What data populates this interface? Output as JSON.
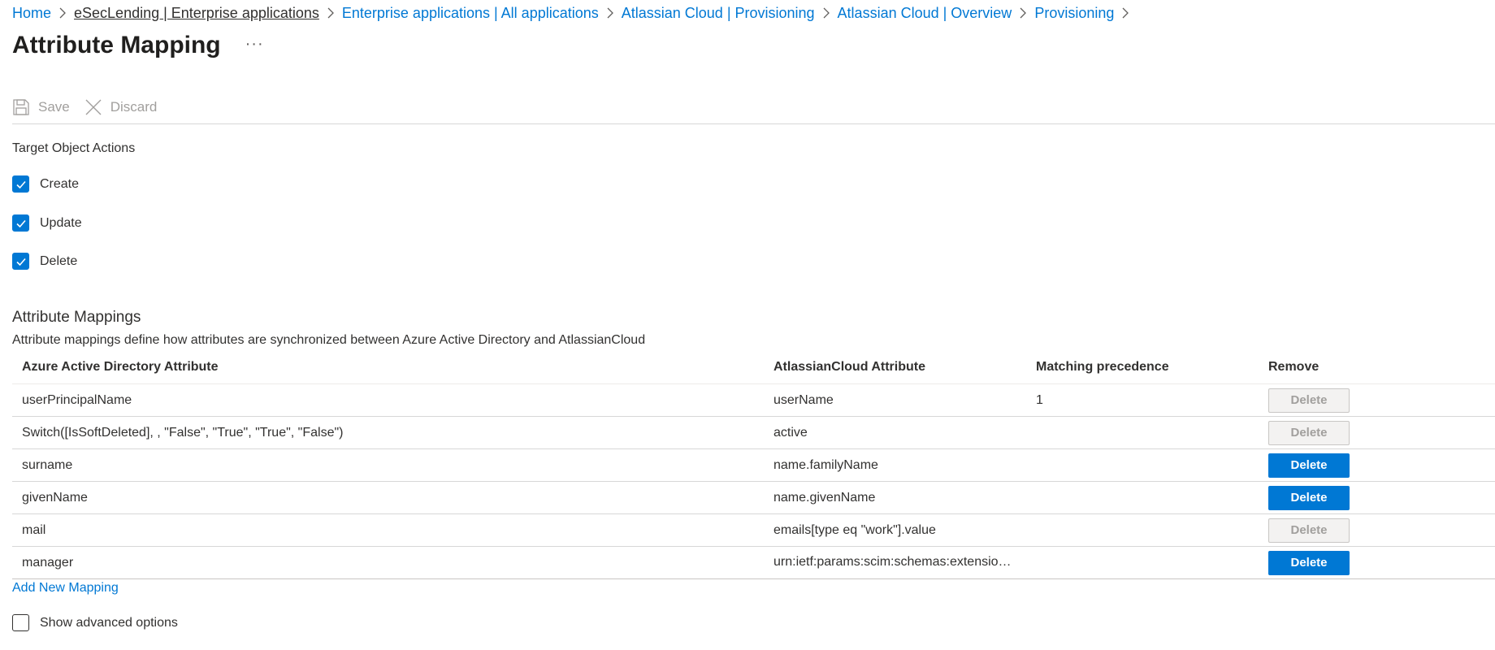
{
  "breadcrumb": {
    "items": [
      {
        "label": "Home"
      },
      {
        "label": "eSecLending | Enterprise applications"
      },
      {
        "label": "Enterprise applications | All applications"
      },
      {
        "label": "Atlassian Cloud | Provisioning"
      },
      {
        "label": "Atlassian Cloud | Overview"
      },
      {
        "label": "Provisioning"
      }
    ]
  },
  "page": {
    "title": "Attribute Mapping",
    "more_label": "···"
  },
  "toolbar": {
    "save_label": "Save",
    "discard_label": "Discard"
  },
  "target_actions": {
    "label": "Target Object Actions",
    "items": [
      {
        "label": "Create",
        "checked": true
      },
      {
        "label": "Update",
        "checked": true
      },
      {
        "label": "Delete",
        "checked": true
      }
    ]
  },
  "mappings": {
    "heading": "Attribute Mappings",
    "description": "Attribute mappings define how attributes are synchronized between Azure Active Directory and AtlassianCloud",
    "columns": [
      "Azure Active Directory Attribute",
      "AtlassianCloud Attribute",
      "Matching precedence",
      "Remove"
    ],
    "rows": [
      {
        "source": "userPrincipalName",
        "target": "userName",
        "precedence": "1",
        "action": "Delete",
        "enabled": false
      },
      {
        "source": "Switch([IsSoftDeleted], , \"False\", \"True\", \"True\", \"False\")",
        "target": "active",
        "precedence": "",
        "action": "Delete",
        "enabled": false
      },
      {
        "source": "surname",
        "target": "name.familyName",
        "precedence": "",
        "action": "Delete",
        "enabled": true
      },
      {
        "source": "givenName",
        "target": "name.givenName",
        "precedence": "",
        "action": "Delete",
        "enabled": true
      },
      {
        "source": "mail",
        "target": "emails[type eq \"work\"].value",
        "precedence": "",
        "action": "Delete",
        "enabled": false
      },
      {
        "source": "manager",
        "target": "urn:ietf:params:scim:schemas:extension:e...",
        "precedence": "",
        "action": "Delete",
        "enabled": true
      }
    ],
    "add_label": "Add New Mapping"
  },
  "advanced": {
    "label": "Show advanced options",
    "checked": false
  },
  "colors": {
    "accent": "#0078d4",
    "text": "#323130",
    "disabled_text": "#a19f9d",
    "disabled_bg": "#f3f2f1"
  }
}
